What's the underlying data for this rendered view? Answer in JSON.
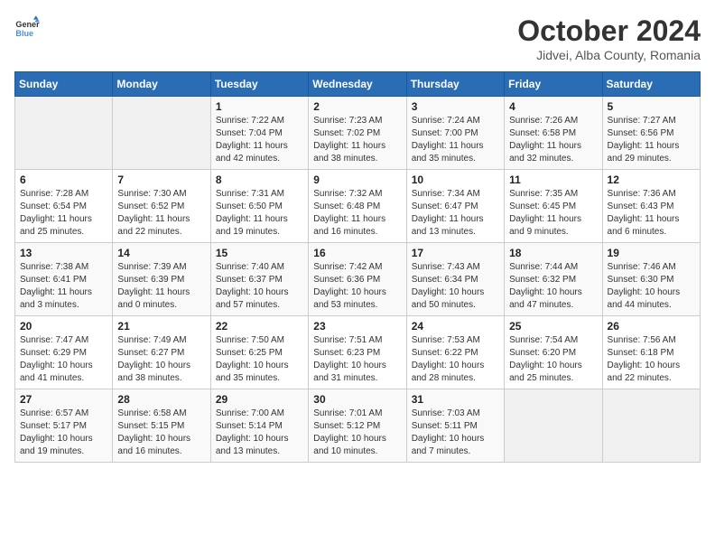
{
  "header": {
    "logo_line1": "General",
    "logo_line2": "Blue",
    "month_title": "October 2024",
    "subtitle": "Jidvei, Alba County, Romania"
  },
  "weekdays": [
    "Sunday",
    "Monday",
    "Tuesday",
    "Wednesday",
    "Thursday",
    "Friday",
    "Saturday"
  ],
  "weeks": [
    [
      {
        "day": "",
        "sunrise": "",
        "sunset": "",
        "daylight": ""
      },
      {
        "day": "",
        "sunrise": "",
        "sunset": "",
        "daylight": ""
      },
      {
        "day": "1",
        "sunrise": "Sunrise: 7:22 AM",
        "sunset": "Sunset: 7:04 PM",
        "daylight": "Daylight: 11 hours and 42 minutes."
      },
      {
        "day": "2",
        "sunrise": "Sunrise: 7:23 AM",
        "sunset": "Sunset: 7:02 PM",
        "daylight": "Daylight: 11 hours and 38 minutes."
      },
      {
        "day": "3",
        "sunrise": "Sunrise: 7:24 AM",
        "sunset": "Sunset: 7:00 PM",
        "daylight": "Daylight: 11 hours and 35 minutes."
      },
      {
        "day": "4",
        "sunrise": "Sunrise: 7:26 AM",
        "sunset": "Sunset: 6:58 PM",
        "daylight": "Daylight: 11 hours and 32 minutes."
      },
      {
        "day": "5",
        "sunrise": "Sunrise: 7:27 AM",
        "sunset": "Sunset: 6:56 PM",
        "daylight": "Daylight: 11 hours and 29 minutes."
      }
    ],
    [
      {
        "day": "6",
        "sunrise": "Sunrise: 7:28 AM",
        "sunset": "Sunset: 6:54 PM",
        "daylight": "Daylight: 11 hours and 25 minutes."
      },
      {
        "day": "7",
        "sunrise": "Sunrise: 7:30 AM",
        "sunset": "Sunset: 6:52 PM",
        "daylight": "Daylight: 11 hours and 22 minutes."
      },
      {
        "day": "8",
        "sunrise": "Sunrise: 7:31 AM",
        "sunset": "Sunset: 6:50 PM",
        "daylight": "Daylight: 11 hours and 19 minutes."
      },
      {
        "day": "9",
        "sunrise": "Sunrise: 7:32 AM",
        "sunset": "Sunset: 6:48 PM",
        "daylight": "Daylight: 11 hours and 16 minutes."
      },
      {
        "day": "10",
        "sunrise": "Sunrise: 7:34 AM",
        "sunset": "Sunset: 6:47 PM",
        "daylight": "Daylight: 11 hours and 13 minutes."
      },
      {
        "day": "11",
        "sunrise": "Sunrise: 7:35 AM",
        "sunset": "Sunset: 6:45 PM",
        "daylight": "Daylight: 11 hours and 9 minutes."
      },
      {
        "day": "12",
        "sunrise": "Sunrise: 7:36 AM",
        "sunset": "Sunset: 6:43 PM",
        "daylight": "Daylight: 11 hours and 6 minutes."
      }
    ],
    [
      {
        "day": "13",
        "sunrise": "Sunrise: 7:38 AM",
        "sunset": "Sunset: 6:41 PM",
        "daylight": "Daylight: 11 hours and 3 minutes."
      },
      {
        "day": "14",
        "sunrise": "Sunrise: 7:39 AM",
        "sunset": "Sunset: 6:39 PM",
        "daylight": "Daylight: 11 hours and 0 minutes."
      },
      {
        "day": "15",
        "sunrise": "Sunrise: 7:40 AM",
        "sunset": "Sunset: 6:37 PM",
        "daylight": "Daylight: 10 hours and 57 minutes."
      },
      {
        "day": "16",
        "sunrise": "Sunrise: 7:42 AM",
        "sunset": "Sunset: 6:36 PM",
        "daylight": "Daylight: 10 hours and 53 minutes."
      },
      {
        "day": "17",
        "sunrise": "Sunrise: 7:43 AM",
        "sunset": "Sunset: 6:34 PM",
        "daylight": "Daylight: 10 hours and 50 minutes."
      },
      {
        "day": "18",
        "sunrise": "Sunrise: 7:44 AM",
        "sunset": "Sunset: 6:32 PM",
        "daylight": "Daylight: 10 hours and 47 minutes."
      },
      {
        "day": "19",
        "sunrise": "Sunrise: 7:46 AM",
        "sunset": "Sunset: 6:30 PM",
        "daylight": "Daylight: 10 hours and 44 minutes."
      }
    ],
    [
      {
        "day": "20",
        "sunrise": "Sunrise: 7:47 AM",
        "sunset": "Sunset: 6:29 PM",
        "daylight": "Daylight: 10 hours and 41 minutes."
      },
      {
        "day": "21",
        "sunrise": "Sunrise: 7:49 AM",
        "sunset": "Sunset: 6:27 PM",
        "daylight": "Daylight: 10 hours and 38 minutes."
      },
      {
        "day": "22",
        "sunrise": "Sunrise: 7:50 AM",
        "sunset": "Sunset: 6:25 PM",
        "daylight": "Daylight: 10 hours and 35 minutes."
      },
      {
        "day": "23",
        "sunrise": "Sunrise: 7:51 AM",
        "sunset": "Sunset: 6:23 PM",
        "daylight": "Daylight: 10 hours and 31 minutes."
      },
      {
        "day": "24",
        "sunrise": "Sunrise: 7:53 AM",
        "sunset": "Sunset: 6:22 PM",
        "daylight": "Daylight: 10 hours and 28 minutes."
      },
      {
        "day": "25",
        "sunrise": "Sunrise: 7:54 AM",
        "sunset": "Sunset: 6:20 PM",
        "daylight": "Daylight: 10 hours and 25 minutes."
      },
      {
        "day": "26",
        "sunrise": "Sunrise: 7:56 AM",
        "sunset": "Sunset: 6:18 PM",
        "daylight": "Daylight: 10 hours and 22 minutes."
      }
    ],
    [
      {
        "day": "27",
        "sunrise": "Sunrise: 6:57 AM",
        "sunset": "Sunset: 5:17 PM",
        "daylight": "Daylight: 10 hours and 19 minutes."
      },
      {
        "day": "28",
        "sunrise": "Sunrise: 6:58 AM",
        "sunset": "Sunset: 5:15 PM",
        "daylight": "Daylight: 10 hours and 16 minutes."
      },
      {
        "day": "29",
        "sunrise": "Sunrise: 7:00 AM",
        "sunset": "Sunset: 5:14 PM",
        "daylight": "Daylight: 10 hours and 13 minutes."
      },
      {
        "day": "30",
        "sunrise": "Sunrise: 7:01 AM",
        "sunset": "Sunset: 5:12 PM",
        "daylight": "Daylight: 10 hours and 10 minutes."
      },
      {
        "day": "31",
        "sunrise": "Sunrise: 7:03 AM",
        "sunset": "Sunset: 5:11 PM",
        "daylight": "Daylight: 10 hours and 7 minutes."
      },
      {
        "day": "",
        "sunrise": "",
        "sunset": "",
        "daylight": ""
      },
      {
        "day": "",
        "sunrise": "",
        "sunset": "",
        "daylight": ""
      }
    ]
  ]
}
